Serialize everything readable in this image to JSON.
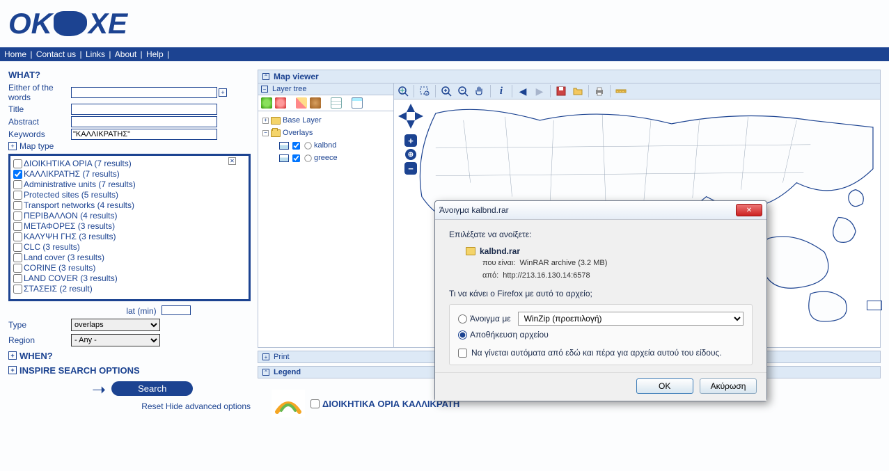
{
  "logo": {
    "left": "OK",
    "right": "XE"
  },
  "nav": {
    "home": "Home",
    "contact": "Contact us",
    "links": "Links",
    "about": "About",
    "help": "Help"
  },
  "search": {
    "what": "WHAT?",
    "either_label": "Either of the words",
    "title_label": "Title",
    "abstract_label": "Abstract",
    "keywords_label": "Keywords",
    "keywords_value": "\"ΚΑΛΛΙΚΡΑΤΗΣ\"",
    "map_type": "Map type",
    "lat_label": "lat (min)",
    "type_label": "Type",
    "type_value": "overlaps",
    "region_label": "Region",
    "region_value": "- Any -",
    "when": "WHEN?",
    "inspire": "INSPIRE SEARCH OPTIONS",
    "search_btn": "Search",
    "reset": "Reset   Hide advanced options"
  },
  "results": [
    {
      "checked": false,
      "label": "ΔΙΟΙΚΗΤΙΚΑ ΟΡΙΑ (7 results)"
    },
    {
      "checked": true,
      "label": "ΚΑΛΛΙΚΡΑΤΗΣ (7 results)"
    },
    {
      "checked": false,
      "label": "Administrative units (7 results)"
    },
    {
      "checked": false,
      "label": "Protected sites (5 results)"
    },
    {
      "checked": false,
      "label": "Transport networks (4 results)"
    },
    {
      "checked": false,
      "label": "ΠΕΡΙΒΑΛΛΟΝ (4 results)"
    },
    {
      "checked": false,
      "label": "ΜΕΤΑΦΟΡΕΣ (3 results)"
    },
    {
      "checked": false,
      "label": "ΚΑΛΥΨΗ ΓΗΣ (3 results)"
    },
    {
      "checked": false,
      "label": "CLC (3 results)"
    },
    {
      "checked": false,
      "label": "Land cover (3 results)"
    },
    {
      "checked": false,
      "label": "CORINE (3 results)"
    },
    {
      "checked": false,
      "label": "LAND COVER (3 results)"
    },
    {
      "checked": false,
      "label": "ΣΤΑΣΕΙΣ (2 result)"
    }
  ],
  "viewer": {
    "title": "Map viewer",
    "layer_tree": "Layer tree",
    "base_layer": "Base Layer",
    "overlays": "Overlays",
    "layer_kalbnd": "kalbnd",
    "layer_greece": "greece",
    "print": "Print",
    "legend": "Legend"
  },
  "result_title": "ΔΙΟΙΚΗΤΙΚΑ ΟΡΙΑ ΚΑΛΛΙΚΡΑΤΗ",
  "dialog": {
    "title": "Άνοιγμα kalbnd.rar",
    "prompt": "Επιλέξατε να ανοίξετε:",
    "filename": "kalbnd.rar",
    "which_label": "που είναι:",
    "which_value": "WinRAR archive (3.2 MB)",
    "from_label": "από:",
    "from_value": "http://213.16.130.14:6578",
    "question": "Τι να κάνει ο Firefox  με αυτό το αρχείο;",
    "open_with": "Άνοιγμα με",
    "open_with_value": "WinZip (προεπιλογή)",
    "save": "Αποθήκευση αρχείου",
    "auto": "Να γίνεται αυτόματα από εδώ και πέρα για αρχεία αυτού του είδους.",
    "ok": "OK",
    "cancel": "Ακύρωση"
  }
}
